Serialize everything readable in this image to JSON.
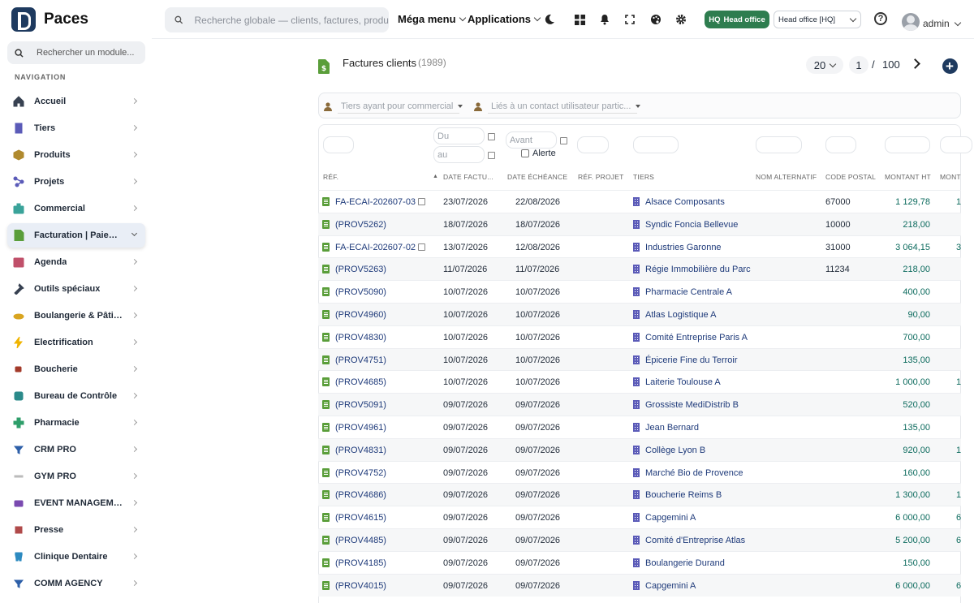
{
  "app": {
    "name": "Paces"
  },
  "topbar": {
    "search_placeholder": "Recherche globale — clients, factures, produits",
    "mega_menu": "Méga menu",
    "applications": "Applications",
    "hq_badge": "Head office",
    "hq_badge_prefix": "HQ",
    "entity_select": "Head office [HQ]",
    "user": "admin"
  },
  "sidebar": {
    "search_placeholder": "Rechercher un module...",
    "section_title": "NAVIGATION",
    "items": [
      {
        "label": "Accueil",
        "icon": "home-icon",
        "color": "#374151"
      },
      {
        "label": "Tiers",
        "icon": "building-icon",
        "color": "#5b5bb8"
      },
      {
        "label": "Produits",
        "icon": "box-icon",
        "color": "#b08a2e"
      },
      {
        "label": "Projets",
        "icon": "project-icon",
        "color": "#5b5bb8"
      },
      {
        "label": "Commercial",
        "icon": "briefcase-icon",
        "color": "#3aa39a"
      },
      {
        "label": "Facturation | Paiement",
        "icon": "invoice-icon",
        "color": "#5a9e3a"
      },
      {
        "label": "Agenda",
        "icon": "calendar-icon",
        "color": "#c0506a"
      },
      {
        "label": "Outils spéciaux",
        "icon": "tools-icon",
        "color": "#374151"
      },
      {
        "label": "Boulangerie & Pâtisserie",
        "icon": "bread-icon",
        "color": "#d9a520"
      },
      {
        "label": "Electrification",
        "icon": "bolt-icon",
        "color": "#f0b400"
      },
      {
        "label": "Boucherie",
        "icon": "meat-icon",
        "color": "#a33a2a"
      },
      {
        "label": "Bureau de Contrôle",
        "icon": "inspection-icon",
        "color": "#2b8a8a"
      },
      {
        "label": "Pharmacie",
        "icon": "cross-icon",
        "color": "#2e9e6a"
      },
      {
        "label": "CRM PRO",
        "icon": "funnel-icon",
        "color": "#2d5fa8"
      },
      {
        "label": "GYM PRO",
        "icon": "gym-icon",
        "color": "#bbbbbb"
      },
      {
        "label": "EVENT MANAGEMENT",
        "icon": "event-icon",
        "color": "#7a4ab0"
      },
      {
        "label": "Presse",
        "icon": "press-icon",
        "color": "#b04a4a"
      },
      {
        "label": "Clinique Dentaire",
        "icon": "tooth-icon",
        "color": "#2d8ac0"
      },
      {
        "label": "COMM AGENCY",
        "icon": "funnel-icon",
        "color": "#2d5fa8"
      }
    ],
    "active_index": 5
  },
  "page": {
    "title": "Factures clients",
    "count": "(1989)",
    "per_page": "20",
    "page": "1",
    "page_sep": "/",
    "total_pages": "100"
  },
  "filters": {
    "commercial_placeholder": "Tiers ayant pour commercial",
    "contact_placeholder": "Liés à un contact utilisateur partic..."
  },
  "table_filters": {
    "date_from": "Du",
    "date_to": "au",
    "due_before": "Avant",
    "alert_label": "Alerte"
  },
  "columns": [
    "RÉF.",
    "DATE FACTU...",
    "DATE ÉCHÉANCE",
    "RÉF. PROJET",
    "TIERS",
    "NOM ALTERNATIF",
    "CODE POSTAL",
    "MONTANT HT",
    "MONT"
  ],
  "rows": [
    {
      "ref": "FA-ECAI-202607-03",
      "note": true,
      "date": "23/07/2026",
      "due": "22/08/2026",
      "tiers": "Alsace Composants",
      "cp": "67000",
      "ht": "1 129,78",
      "extra": "1"
    },
    {
      "ref": "(PROV5262)",
      "note": false,
      "date": "18/07/2026",
      "due": "18/07/2026",
      "tiers": "Syndic Foncia Bellevue",
      "cp": "10000",
      "ht": "218,00",
      "extra": ""
    },
    {
      "ref": "FA-ECAI-202607-02",
      "note": true,
      "date": "13/07/2026",
      "due": "12/08/2026",
      "tiers": "Industries Garonne",
      "cp": "31000",
      "ht": "3 064,15",
      "extra": "3"
    },
    {
      "ref": "(PROV5263)",
      "note": false,
      "date": "11/07/2026",
      "due": "11/07/2026",
      "tiers": "Régie Immobilière du Parc",
      "cp": "11234",
      "ht": "218,00",
      "extra": ""
    },
    {
      "ref": "(PROV5090)",
      "note": false,
      "date": "10/07/2026",
      "due": "10/07/2026",
      "tiers": "Pharmacie Centrale A",
      "cp": "",
      "ht": "400,00",
      "extra": ""
    },
    {
      "ref": "(PROV4960)",
      "note": false,
      "date": "10/07/2026",
      "due": "10/07/2026",
      "tiers": "Atlas Logistique A",
      "cp": "",
      "ht": "90,00",
      "extra": ""
    },
    {
      "ref": "(PROV4830)",
      "note": false,
      "date": "10/07/2026",
      "due": "10/07/2026",
      "tiers": "Comité Entreprise Paris A",
      "cp": "",
      "ht": "700,00",
      "extra": ""
    },
    {
      "ref": "(PROV4751)",
      "note": false,
      "date": "10/07/2026",
      "due": "10/07/2026",
      "tiers": "Épicerie Fine du Terroir",
      "cp": "",
      "ht": "135,00",
      "extra": ""
    },
    {
      "ref": "(PROV4685)",
      "note": false,
      "date": "10/07/2026",
      "due": "10/07/2026",
      "tiers": "Laiterie Toulouse A",
      "cp": "",
      "ht": "1 000,00",
      "extra": "1"
    },
    {
      "ref": "(PROV5091)",
      "note": false,
      "date": "09/07/2026",
      "due": "09/07/2026",
      "tiers": "Grossiste MediDistrib B",
      "cp": "",
      "ht": "520,00",
      "extra": ""
    },
    {
      "ref": "(PROV4961)",
      "note": false,
      "date": "09/07/2026",
      "due": "09/07/2026",
      "tiers": "Jean Bernard",
      "cp": "",
      "ht": "135,00",
      "extra": ""
    },
    {
      "ref": "(PROV4831)",
      "note": false,
      "date": "09/07/2026",
      "due": "09/07/2026",
      "tiers": "Collège Lyon B",
      "cp": "",
      "ht": "920,00",
      "extra": "1"
    },
    {
      "ref": "(PROV4752)",
      "note": false,
      "date": "09/07/2026",
      "due": "09/07/2026",
      "tiers": "Marché Bio de Provence",
      "cp": "",
      "ht": "160,00",
      "extra": ""
    },
    {
      "ref": "(PROV4686)",
      "note": false,
      "date": "09/07/2026",
      "due": "09/07/2026",
      "tiers": "Boucherie Reims B",
      "cp": "",
      "ht": "1 300,00",
      "extra": "1"
    },
    {
      "ref": "(PROV4615)",
      "note": false,
      "date": "09/07/2026",
      "due": "09/07/2026",
      "tiers": "Capgemini A",
      "cp": "",
      "ht": "6 000,00",
      "extra": "6"
    },
    {
      "ref": "(PROV4485)",
      "note": false,
      "date": "09/07/2026",
      "due": "09/07/2026",
      "tiers": "Comité d'Entreprise Atlas",
      "cp": "",
      "ht": "5 200,00",
      "extra": "6"
    },
    {
      "ref": "(PROV4185)",
      "note": false,
      "date": "09/07/2026",
      "due": "09/07/2026",
      "tiers": "Boulangerie Durand",
      "cp": "",
      "ht": "150,00",
      "extra": ""
    },
    {
      "ref": "(PROV4015)",
      "note": false,
      "date": "09/07/2026",
      "due": "09/07/2026",
      "tiers": "Capgemini A",
      "cp": "",
      "ht": "6 000,00",
      "extra": "6"
    }
  ],
  "colors": {
    "brand": "#1e3a5f",
    "hq_green": "#2e7d4f",
    "amount": "#0d6b5e",
    "link": "#1e3a7a",
    "invoice_green": "#5a9e3a"
  }
}
